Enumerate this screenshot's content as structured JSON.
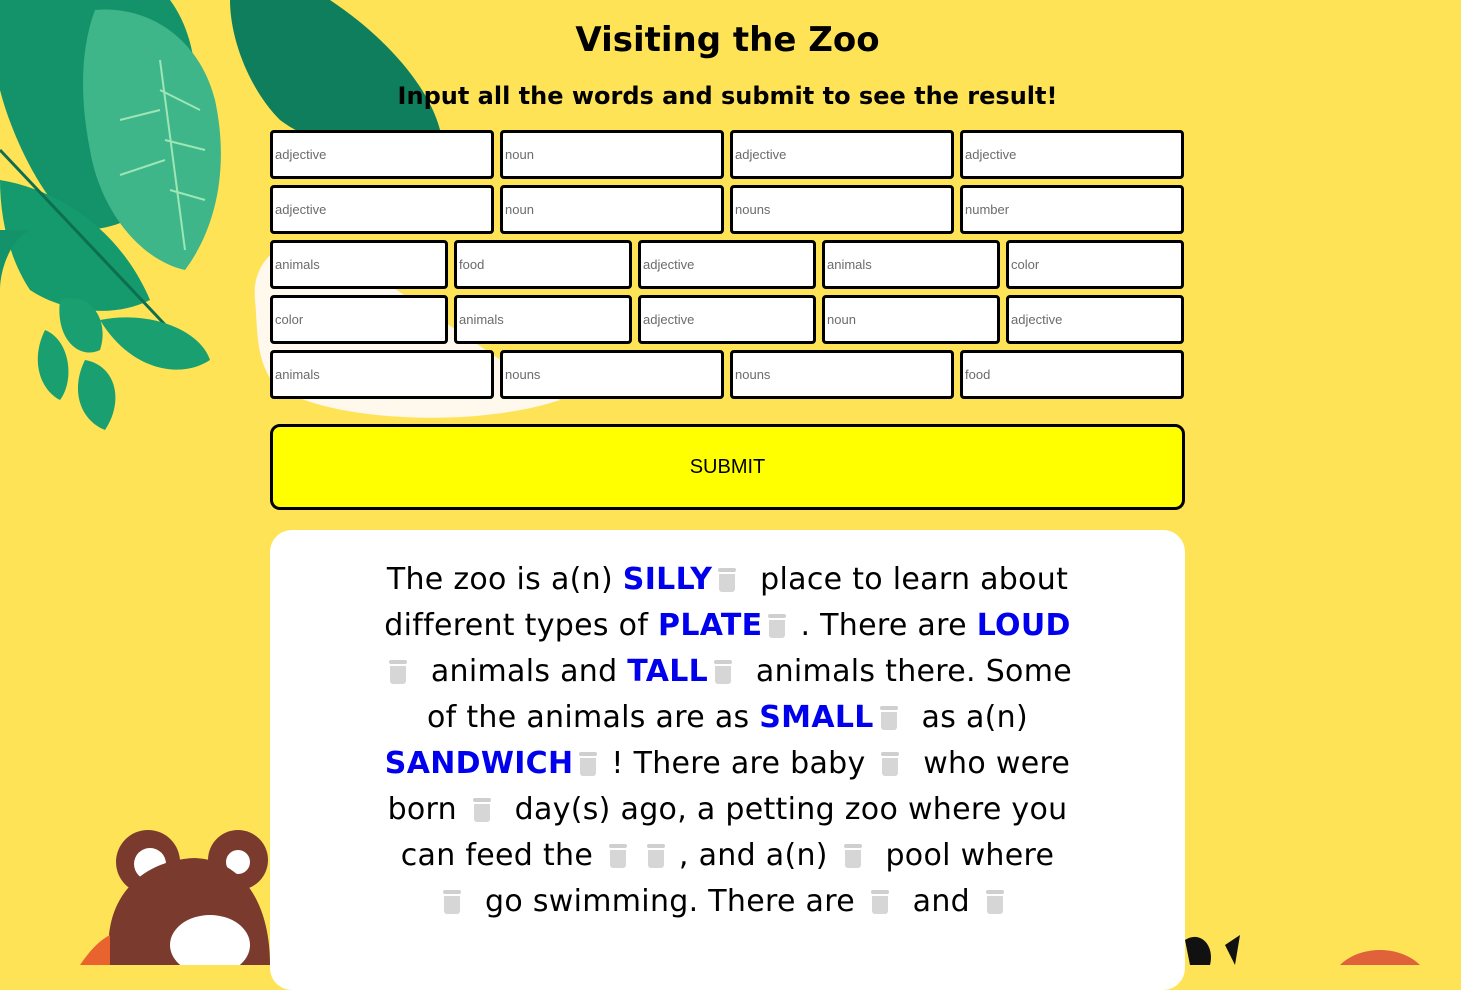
{
  "title": "Visiting the Zoo",
  "subtitle": "Input all the words and submit to see the result!",
  "inputs": {
    "row1": [
      "adjective",
      "noun",
      "adjective",
      "adjective"
    ],
    "row2": [
      "adjective",
      "noun",
      "nouns",
      "number"
    ],
    "row3": [
      "animals",
      "food",
      "adjective",
      "animals",
      "color"
    ],
    "row4": [
      "color",
      "animals",
      "adjective",
      "noun",
      "adjective"
    ],
    "row5": [
      "animals",
      "nouns",
      "nouns",
      "food"
    ]
  },
  "submit_label": "SUBMIT",
  "story": {
    "t1": "The zoo is a(n) ",
    "w1": "SILLY",
    "t2": " place to learn about different types of ",
    "w2": "PLATE",
    "t3": ". There are ",
    "w3": "LOUD",
    "t4": " animals and ",
    "w4": "TALL",
    "t5": " animals there. Some of the animals are as ",
    "w5": "SMALL",
    "t6": " as a(n) ",
    "w6": "SANDWICH",
    "t7": "! There are baby ",
    "t8": " who were born ",
    "t9": " day(s) ago, a petting zoo where you can feed the ",
    "t10": ", and a(n) ",
    "t11": " pool where ",
    "t12": " go swimming. There are ",
    "t13": " and "
  },
  "colors": {
    "background": "#ffe357",
    "submit": "#ffff00",
    "filled_word": "#0000ee",
    "leaf_dark": "#0e8a63",
    "leaf_light": "#22a072",
    "bear": "#7a3b2e"
  }
}
